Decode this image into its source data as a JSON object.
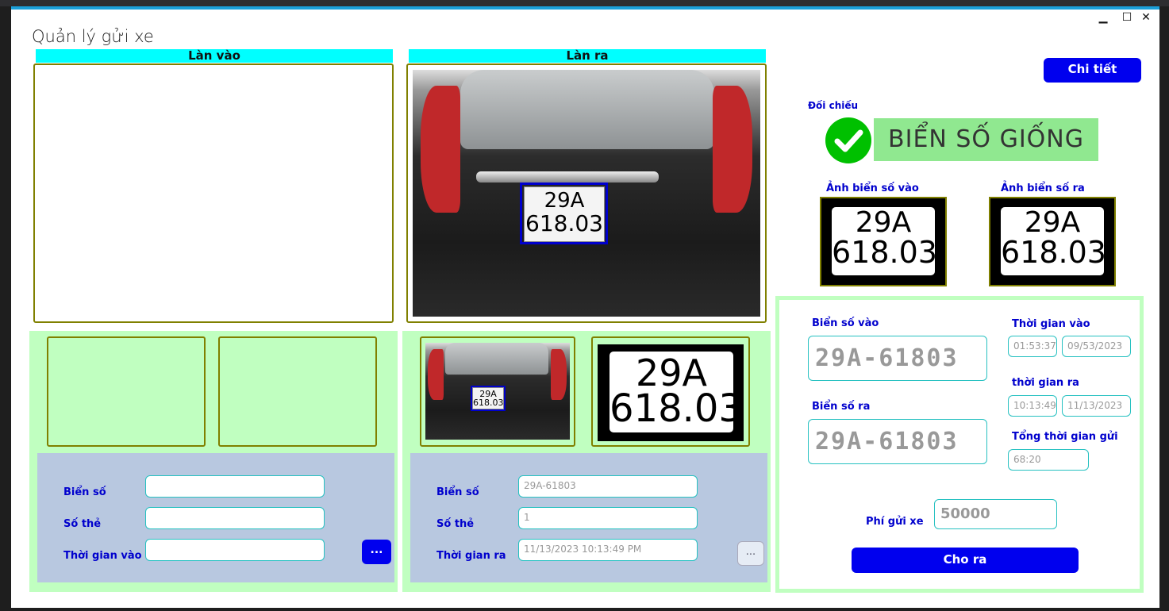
{
  "window": {
    "title": "Quản lý gửi xe",
    "minimize": "▁",
    "maximize": "☐",
    "close": "✕"
  },
  "lane_in": {
    "header": "Làn vào",
    "form": {
      "plate_label": "Biển số",
      "plate_value": "",
      "card_label": "Số thẻ",
      "card_value": "",
      "time_label": "Thời gian vào",
      "time_value": "",
      "more_button": "..."
    }
  },
  "lane_out": {
    "header": "Làn ra",
    "plate_text_line1": "29A",
    "plate_text_line2": "618.03",
    "form": {
      "plate_label": "Biển số",
      "plate_value": "29A-61803",
      "card_label": "Số thẻ",
      "card_value": "1",
      "time_label": "Thời gian ra",
      "time_value": "11/13/2023 10:13:49 PM",
      "more_button": "..."
    }
  },
  "compare": {
    "detail_button": "Chi tiết",
    "label": "Đối chiếu",
    "result": "BIỂN SỐ GIỐNG",
    "result_color": "#90e890",
    "check_color": "#00c000",
    "plate_in_label": "Ảnh biển số vào",
    "plate_out_label": "Ảnh biển số ra"
  },
  "summary": {
    "plate_in_label": "Biển số vào",
    "plate_in_value": "29A-61803",
    "plate_out_label": "Biển số ra",
    "plate_out_value": "29A-61803",
    "time_in_label": "Thời gian vào",
    "time_in_clock": "01:53:37",
    "time_in_date": "09/53/2023",
    "time_out_label": "thời gian ra",
    "time_out_clock": "10:13:49",
    "time_out_date": "11/13/2023",
    "total_label": "Tổng thời gian gửi",
    "total_value": "68:20",
    "fee_label": "Phí gửi xe",
    "fee_value": "50000",
    "release_button": "Cho ra"
  },
  "colors": {
    "lane_header": "#00ffff",
    "panel_green": "#c0ffc0",
    "panel_blue": "#b8c8e0",
    "accent_blue": "#0000ee",
    "label_blue": "#0000cd",
    "border_olive": "#808000"
  }
}
